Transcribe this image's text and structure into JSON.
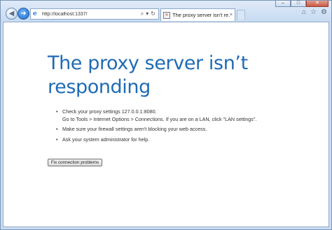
{
  "browser": {
    "address_bar": {
      "url": "http://localhost:1337/",
      "icons": [
        "search-icon",
        "dropdown-icon",
        "refresh-icon"
      ]
    },
    "tab": {
      "title": "The proxy server isn't re...",
      "close_label": "×"
    },
    "toolbar_icons": [
      "home-icon",
      "favorites-star-icon",
      "gear-icon"
    ],
    "window_controls": [
      "minimize",
      "maximize",
      "close"
    ]
  },
  "page": {
    "heading_line1": "The proxy server isn’t",
    "heading_line2": "responding",
    "tips": [
      {
        "line1": "Check your proxy settings 127.0.0.1:8080.",
        "line2": "Go to Tools > Internet Options > Connections. If you are on a LAN, click \"LAN settings\"."
      },
      {
        "line1": "Make sure your firewall settings aren't blocking your web access."
      },
      {
        "line1": "Ask your system administrator for help."
      }
    ],
    "fix_button_label": "Fix connection problems"
  }
}
